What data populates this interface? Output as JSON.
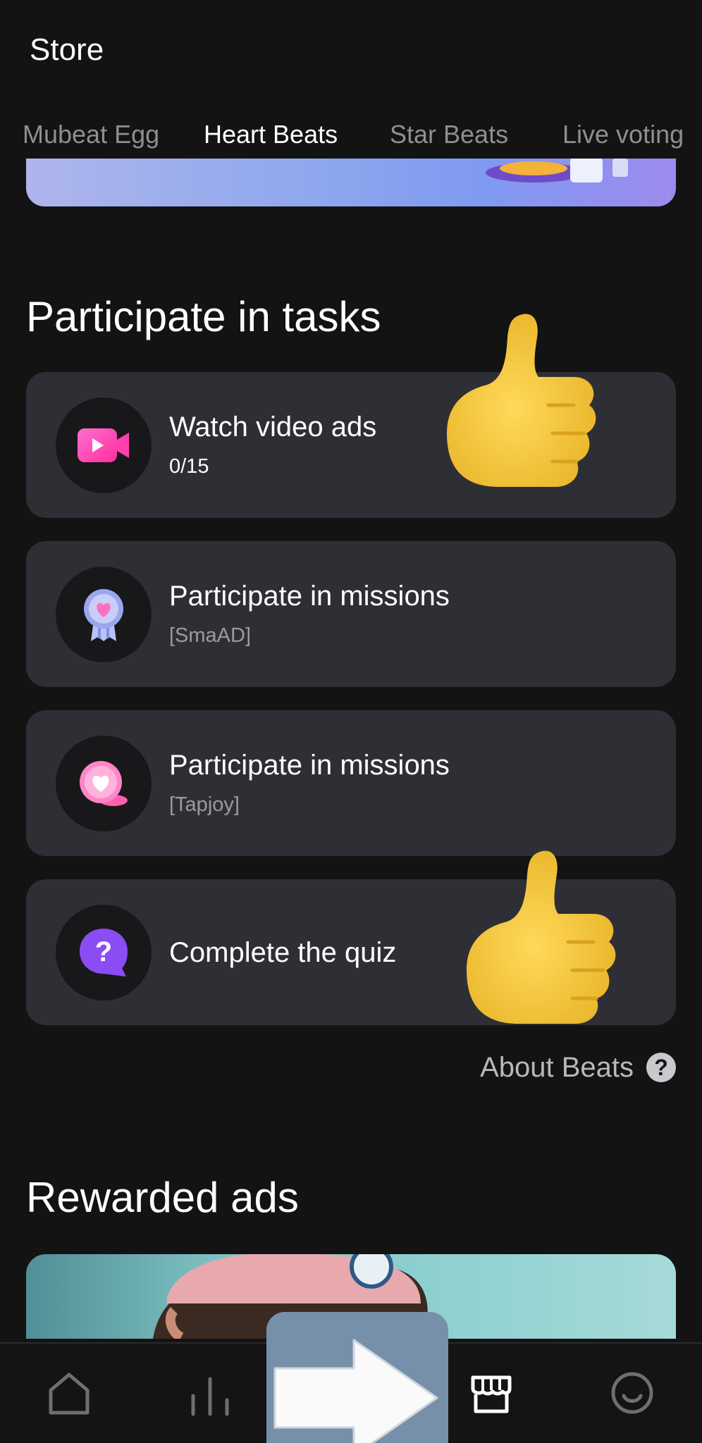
{
  "header": {
    "title": "Store"
  },
  "tabs": [
    {
      "label": "Mubeat Egg",
      "active": false
    },
    {
      "label": "Heart Beats",
      "active": true
    },
    {
      "label": "Star Beats",
      "active": false
    },
    {
      "label": "Live voting",
      "active": false
    }
  ],
  "tasks_section": {
    "title": "Participate in tasks",
    "items": [
      {
        "title": "Watch video ads",
        "subtitle": "0/15",
        "icon": "video-camera-icon"
      },
      {
        "title": "Participate in missions",
        "subtitle": "[SmaAD]",
        "icon": "medal-heart-icon"
      },
      {
        "title": "Participate in missions",
        "subtitle": "[Tapjoy]",
        "icon": "heart-coin-icon"
      },
      {
        "title": "Complete the quiz",
        "subtitle": "",
        "icon": "question-bubble-icon"
      }
    ]
  },
  "about": {
    "label": "About Beats",
    "help_icon_glyph": "?"
  },
  "rewarded_section": {
    "title": "Rewarded ads"
  },
  "bottom_nav": [
    {
      "name": "home-icon"
    },
    {
      "name": "chart-icon"
    },
    {
      "name": "store-icon",
      "active": true
    },
    {
      "name": "profile-icon"
    }
  ],
  "overlays": {
    "thumbs_up": "thumbs-up-emoji",
    "arrow": "right-arrow-icon"
  },
  "colors": {
    "background": "#131314",
    "card": "#2e2f35",
    "tab_active": "#ffffff",
    "tab_inactive": "#8e8e93",
    "accent_pink": "#ff4fb8",
    "accent_purple": "#8b4cf4"
  }
}
